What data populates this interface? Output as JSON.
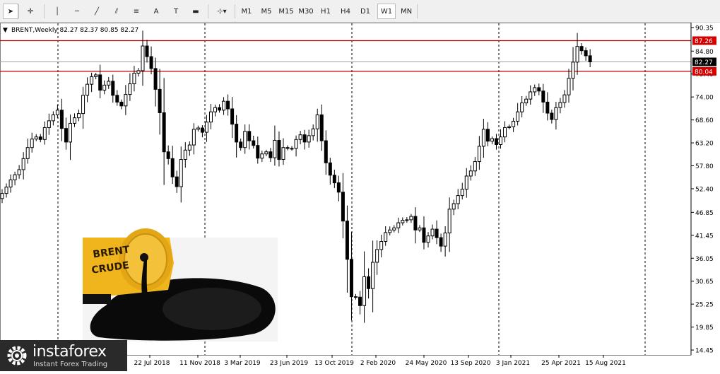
{
  "toolbar": {
    "tools": [
      {
        "name": "cursor-icon",
        "glyph": "➤"
      },
      {
        "name": "crosshair-icon",
        "glyph": "✛"
      },
      {
        "name": "vertical-line-icon",
        "glyph": "│"
      },
      {
        "name": "horizontal-line-icon",
        "glyph": "─"
      },
      {
        "name": "trendline-icon",
        "glyph": "╱"
      },
      {
        "name": "equidistant-channel-icon",
        "glyph": "⫽"
      },
      {
        "name": "fibonacci-icon",
        "glyph": "≡"
      },
      {
        "name": "text-icon",
        "glyph": "A"
      },
      {
        "name": "text-label-icon",
        "glyph": "T"
      },
      {
        "name": "rectangle-icon",
        "glyph": "▬"
      },
      {
        "name": "shapes-dropdown-icon",
        "glyph": "⊹▾"
      }
    ],
    "timeframes": [
      "M1",
      "M5",
      "M15",
      "M30",
      "H1",
      "H4",
      "D1",
      "W1",
      "MN"
    ],
    "selected_timeframe": "W1"
  },
  "chart_header": {
    "symbol": "BRENT,Weekly",
    "ohlc": "82.27 82.37 80.85 82.27"
  },
  "colors": {
    "candle": "#000000",
    "grid": "#000000",
    "level_line": "#c00000",
    "level_tag_bg": "#d40000",
    "price_tag_bg": "#000000"
  },
  "chart_data": {
    "type": "candlestick",
    "x": [
      "22 Jul 2018",
      "11 Nov 2018",
      "3 Mar 2019",
      "23 Jun 2019",
      "13 Oct 2019",
      "2 Feb 2020",
      "24 May 2020",
      "13 Sep 2020",
      "3 Jan 2021",
      "25 Apr 2021",
      "15 Aug 2021"
    ],
    "x_partial_labels": [
      "20",
      "8"
    ],
    "y_ticks": [
      90.35,
      84.8,
      79.4,
      74.0,
      68.6,
      63.2,
      57.8,
      52.4,
      46.85,
      41.45,
      36.05,
      30.65,
      25.25,
      19.85,
      14.45
    ],
    "ylim": [
      13.3,
      91.5
    ],
    "levels": [
      87.26,
      80.04
    ],
    "current_price": 82.27,
    "close_series": [
      51.3,
      52.8,
      54.5,
      55.7,
      56.9,
      59.5,
      62.1,
      64.1,
      64.6,
      64.0,
      66.8,
      68.4,
      69.8,
      70.9,
      66.6,
      63.4,
      67.8,
      69.1,
      70.1,
      74.4,
      77.0,
      78.8,
      79.2,
      75.6,
      76.8,
      77.7,
      74.4,
      72.8,
      71.9,
      74.6,
      77.1,
      79.6,
      80.2,
      86.0,
      83.5,
      80.7,
      75.8,
      70.3,
      61.1,
      59.5,
      55.2,
      52.9,
      59.3,
      61.5,
      62.7,
      66.4,
      66.7,
      65.7,
      68.1,
      70.5,
      71.5,
      70.9,
      73.0,
      71.2,
      67.6,
      63.4,
      62.1,
      65.9,
      63.7,
      62.6,
      59.6,
      60.6,
      61.1,
      59.7,
      63.8,
      59.3,
      62.1,
      61.9,
      61.9,
      64.0,
      65.1,
      63.4,
      64.9,
      66.5,
      69.8,
      63.7,
      58.5,
      55.6,
      53.8,
      51.6,
      44.8,
      35.8,
      27.0,
      26.9,
      24.9,
      31.7,
      28.9,
      35.1,
      38.1,
      40.0,
      42.1,
      42.7,
      43.2,
      44.4,
      45.0,
      45.1,
      45.9,
      42.7,
      43.2,
      39.8,
      41.3,
      42.9,
      40.9,
      38.9,
      42.0,
      47.6,
      48.9,
      50.8,
      52.3,
      55.4,
      56.6,
      58.8,
      62.4,
      66.4,
      63.6,
      64.2,
      62.8,
      64.6,
      66.8,
      67.0,
      68.3,
      70.5,
      72.6,
      73.5,
      75.2,
      76.2,
      75.4,
      72.8,
      70.2,
      68.7,
      71.5,
      72.7,
      74.5,
      78.4,
      82.2,
      85.9,
      84.9,
      83.7,
      82.27
    ]
  }
}
